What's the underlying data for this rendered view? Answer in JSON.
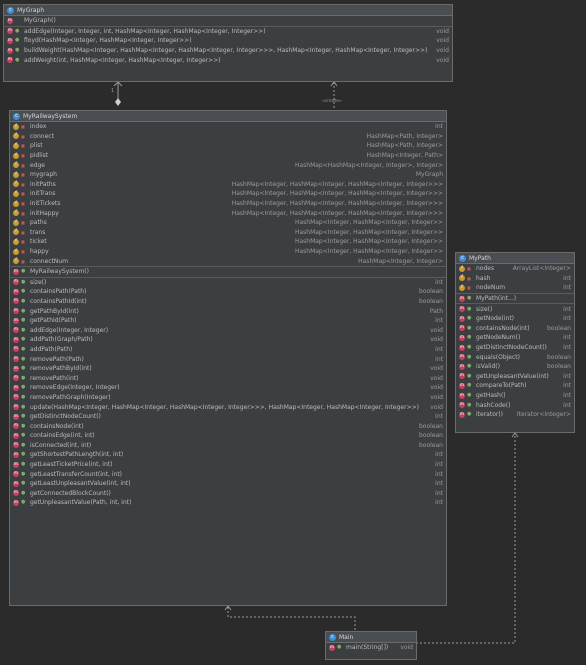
{
  "classes": {
    "mygraph": {
      "name": "MyGraph",
      "icon": "class-icon",
      "constructors": [
        {
          "name": "MyGraph()",
          "type": ""
        }
      ],
      "methods": [
        {
          "name": "addEdge(Integer, Integer, int, HashMap<Integer, HashMap<Integer, Integer>>)",
          "type": "void"
        },
        {
          "name": "floyd(HashMap<Integer, HashMap<Integer, Integer>>)",
          "type": "void"
        },
        {
          "name": "buildWeight(HashMap<Integer, HashMap<Integer, HashMap<Integer, Integer>>>, HashMap<Integer, HashMap<Integer, Integer>>)",
          "type": "void"
        },
        {
          "name": "addWeight(int, HashMap<Integer, HashMap<Integer, Integer>>)",
          "type": "void"
        }
      ]
    },
    "myrailwaysystem": {
      "name": "MyRailwaySystem",
      "icon": "class-icon",
      "fields": [
        {
          "name": "index",
          "type": "int"
        },
        {
          "name": "connect",
          "type": "HashMap<Path, Integer>"
        },
        {
          "name": "plist",
          "type": "HashMap<Path, Integer>"
        },
        {
          "name": "pidlist",
          "type": "HashMap<Integer, Path>"
        },
        {
          "name": "edge",
          "type": "HashMap<HashMap<Integer, Integer>, Integer>"
        },
        {
          "name": "mygraph",
          "type": "MyGraph"
        },
        {
          "name": "initPaths",
          "type": "HashMap<Integer, HashMap<Integer, HashMap<Integer, Integer>>>"
        },
        {
          "name": "initTrans",
          "type": "HashMap<Integer, HashMap<Integer, HashMap<Integer, Integer>>>"
        },
        {
          "name": "initTickets",
          "type": "HashMap<Integer, HashMap<Integer, HashMap<Integer, Integer>>>"
        },
        {
          "name": "initHappy",
          "type": "HashMap<Integer, HashMap<Integer, HashMap<Integer, Integer>>>"
        },
        {
          "name": "paths",
          "type": "HashMap<Integer, HashMap<Integer, Integer>>"
        },
        {
          "name": "trans",
          "type": "HashMap<Integer, HashMap<Integer, Integer>>"
        },
        {
          "name": "ticket",
          "type": "HashMap<Integer, HashMap<Integer, Integer>>"
        },
        {
          "name": "happy",
          "type": "HashMap<Integer, HashMap<Integer, Integer>>"
        },
        {
          "name": "connectNum",
          "type": "HashMap<Integer, Integer>"
        }
      ],
      "constructors": [
        {
          "name": "MyRailwaySystem()",
          "type": ""
        }
      ],
      "methods": [
        {
          "name": "size()",
          "type": "int"
        },
        {
          "name": "containsPath(Path)",
          "type": "boolean"
        },
        {
          "name": "containsPathId(int)",
          "type": "boolean"
        },
        {
          "name": "getPathById(int)",
          "type": "Path"
        },
        {
          "name": "getPathId(Path)",
          "type": "int"
        },
        {
          "name": "addEdge(Integer, Integer)",
          "type": "void"
        },
        {
          "name": "addPath(Graph/Path)",
          "type": "void"
        },
        {
          "name": "addPath(Path)",
          "type": "int"
        },
        {
          "name": "removePath(Path)",
          "type": "int"
        },
        {
          "name": "removePathById(int)",
          "type": "void"
        },
        {
          "name": "removePath(int)",
          "type": "void"
        },
        {
          "name": "removeEdge(Integer, Integer)",
          "type": "void"
        },
        {
          "name": "removePathGraph(Integer)",
          "type": "void"
        },
        {
          "name": "update(HashMap<Integer, HashMap<Integer, HashMap<Integer, Integer>>>, HashMap<Integer, HashMap<Integer, Integer>>)",
          "type": "void"
        },
        {
          "name": "getDistinctNodeCount()",
          "type": "int"
        },
        {
          "name": "containsNode(int)",
          "type": "boolean"
        },
        {
          "name": "containsEdge(int, int)",
          "type": "boolean"
        },
        {
          "name": "isConnected(int, int)",
          "type": "boolean"
        },
        {
          "name": "getShortestPathLength(int, int)",
          "type": "int"
        },
        {
          "name": "getLeastTicketPrice(int, int)",
          "type": "int"
        },
        {
          "name": "getLeastTransferCount(int, int)",
          "type": "int"
        },
        {
          "name": "getLeastUnpleasantValue(int, int)",
          "type": "int"
        },
        {
          "name": "getConnectedBlockCount()",
          "type": "int"
        },
        {
          "name": "getUnpleasantValue(Path, int, int)",
          "type": "int"
        }
      ]
    },
    "mypath": {
      "name": "MyPath",
      "icon": "class-icon",
      "fields": [
        {
          "name": "nodes",
          "type": "ArrayList<Integer>"
        },
        {
          "name": "hash",
          "type": "int"
        },
        {
          "name": "nodeNum",
          "type": "int"
        }
      ],
      "constructors": [
        {
          "name": "MyPath(int...)",
          "type": ""
        }
      ],
      "methods": [
        {
          "name": "size()",
          "type": "int"
        },
        {
          "name": "getNode(int)",
          "type": "int"
        },
        {
          "name": "containsNode(int)",
          "type": "boolean"
        },
        {
          "name": "getNodeNum()",
          "type": "int"
        },
        {
          "name": "getDistinctNodeCount()",
          "type": "int"
        },
        {
          "name": "equals(Object)",
          "type": "boolean"
        },
        {
          "name": "isValid()",
          "type": "boolean"
        },
        {
          "name": "getUnpleasantValue(int)",
          "type": "int"
        },
        {
          "name": "compareTo(Path)",
          "type": "int"
        },
        {
          "name": "getHash()",
          "type": "int"
        },
        {
          "name": "hashCode()",
          "type": "int"
        },
        {
          "name": "iterator()",
          "type": "Iterator<Integer>"
        }
      ]
    },
    "main": {
      "name": "Main",
      "icon": "class-icon",
      "methods": [
        {
          "name": "main(String[])",
          "type": "void"
        }
      ]
    }
  },
  "relations": [
    {
      "from": "MyRailwaySystem",
      "to": "MyGraph",
      "kind": "composition",
      "label": "1"
    },
    {
      "from": "MyRailwaySystem",
      "to": "MyGraph",
      "kind": "dependency",
      "label": "«create»"
    },
    {
      "from": "Main",
      "to": "MyRailwaySystem",
      "kind": "dependency",
      "label": ""
    },
    {
      "from": "Main",
      "to": "MyPath",
      "kind": "dependency",
      "label": ""
    }
  ]
}
